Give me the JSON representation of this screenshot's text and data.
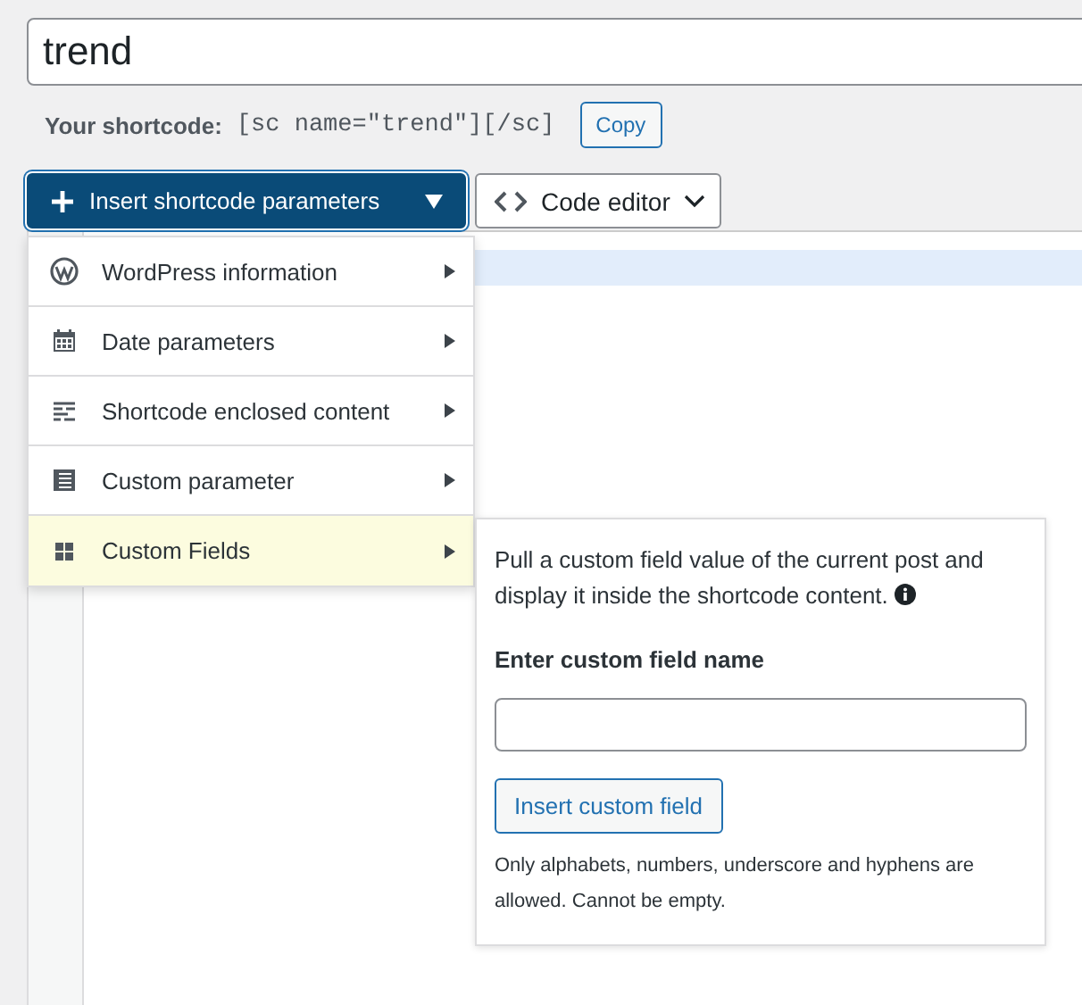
{
  "title_field": {
    "value": "trend"
  },
  "shortcode": {
    "label": "Your shortcode:",
    "code": "[sc name=\"trend\"][/sc]",
    "copy_button": "Copy"
  },
  "toolbar": {
    "insert_button": "Insert shortcode parameters",
    "editor_button": "Code editor"
  },
  "menu": {
    "items": [
      {
        "label": "WordPress information",
        "kind": "wordpress",
        "selected": false
      },
      {
        "label": "Date parameters",
        "kind": "calendar",
        "selected": false
      },
      {
        "label": "Shortcode enclosed content",
        "kind": "lines",
        "selected": false
      },
      {
        "label": "Custom parameter",
        "kind": "table",
        "selected": false
      },
      {
        "label": "Custom Fields",
        "kind": "grid",
        "selected": true
      }
    ]
  },
  "submenu": {
    "description": "Pull a custom field value of the current post and display it inside the shortcode content.",
    "field_label": "Enter custom field name",
    "button": "Insert custom field",
    "note": "Only alphabets, numbers, underscore and hyphens are allowed. Cannot be empty."
  }
}
